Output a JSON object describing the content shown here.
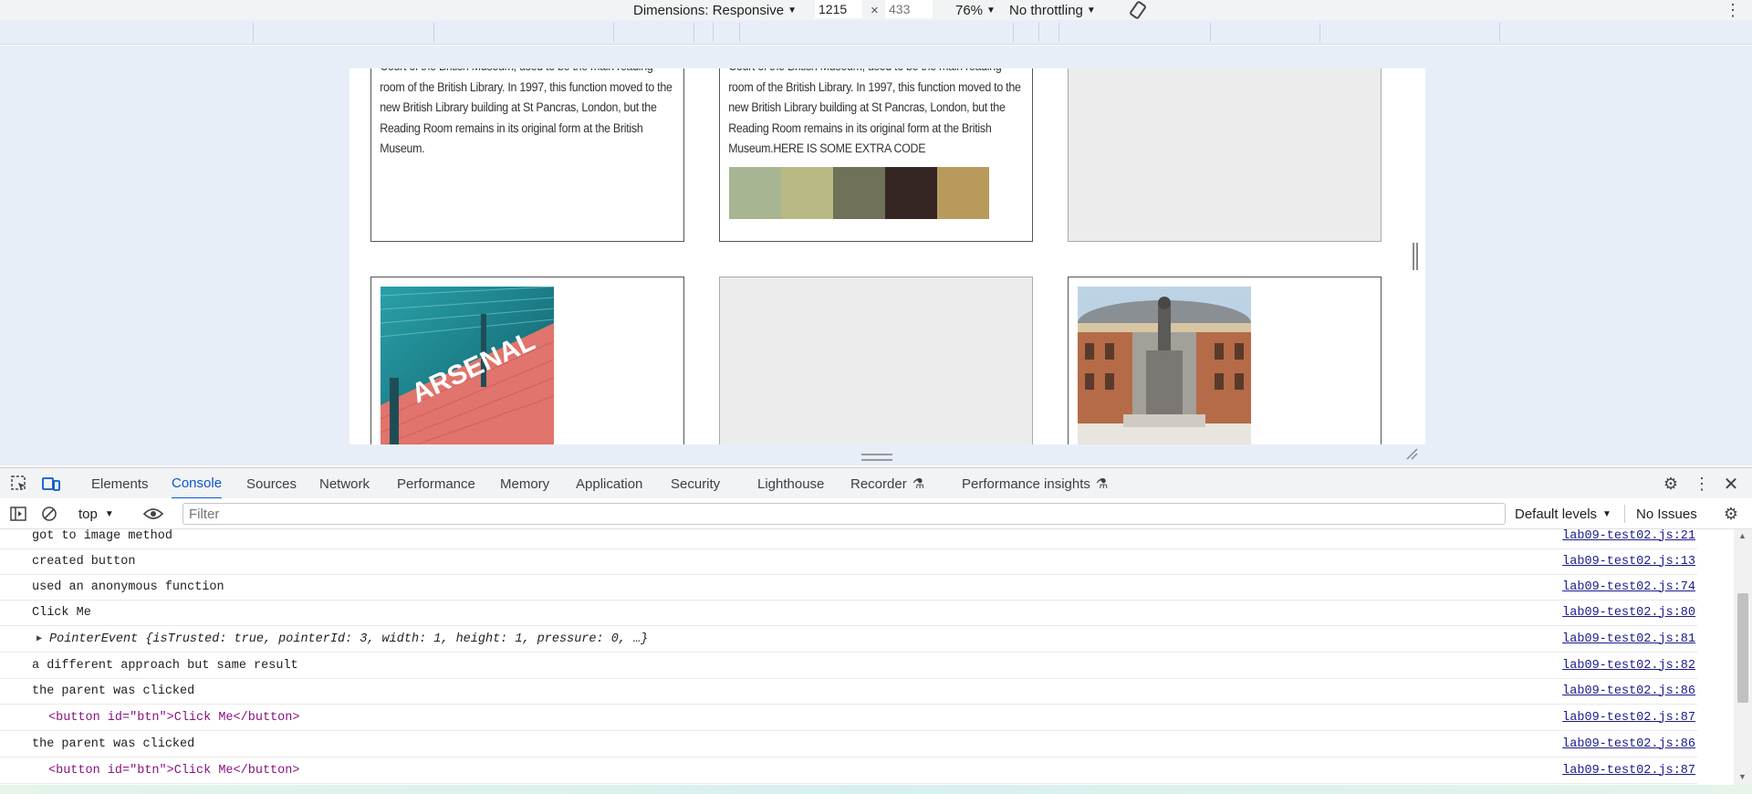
{
  "device_toolbar": {
    "dimensions_label": "Dimensions: Responsive",
    "width_value": "1215",
    "times": "×",
    "height_placeholder": "433",
    "zoom": "76%",
    "throttling": "No throttling"
  },
  "page": {
    "card1_text": "Court of the British Museum, used to be the main reading room of the British Library. In 1997, this function moved to the new British Library building at St Pancras, London, but the Reading Room remains in its original form at the British Museum.",
    "card2_text": "Court of the British Museum, used to be the main reading room of the British Library. In 1997, this function moved to the new British Library building at St Pancras, London, but the Reading Room remains in its original form at the British Museum.HERE IS SOME EXTRA CODE",
    "swatch_colors": [
      "#a8b592",
      "#b8b984",
      "#6f7158",
      "#352624",
      "#b89b5c"
    ],
    "photo1_text": "ARSENAL"
  },
  "devtools": {
    "tabs": [
      "Elements",
      "Console",
      "Sources",
      "Network",
      "Performance",
      "Memory",
      "Application",
      "Security",
      "Lighthouse",
      "Recorder",
      "Performance insights"
    ],
    "active_tab": "Console",
    "context": "top",
    "filter_placeholder": "Filter",
    "levels": "Default levels",
    "issues": "No Issues"
  },
  "console_rows": [
    {
      "text": "got to image method",
      "src": "lab09-test02.js:21"
    },
    {
      "text": "created button",
      "src": "lab09-test02.js:13"
    },
    {
      "text": "used an anonymous function",
      "src": "lab09-test02.js:74"
    },
    {
      "text": "Click Me",
      "src": "lab09-test02.js:80"
    },
    {
      "text": "PointerEvent {isTrusted: true, pointerId: 3, width: 1, height: 1, pressure: 0, …}",
      "src": "lab09-test02.js:81"
    },
    {
      "text": "a different approach but same result",
      "src": "lab09-test02.js:82"
    },
    {
      "text": "the parent was clicked",
      "src": "lab09-test02.js:86"
    },
    {
      "text": "<button id=\"btn\">Click Me</button>",
      "src": "lab09-test02.js:87"
    },
    {
      "text": "the parent was clicked",
      "src": "lab09-test02.js:86"
    },
    {
      "text": "<button id=\"btn\">Click Me</button>",
      "src": "lab09-test02.js:87"
    }
  ]
}
